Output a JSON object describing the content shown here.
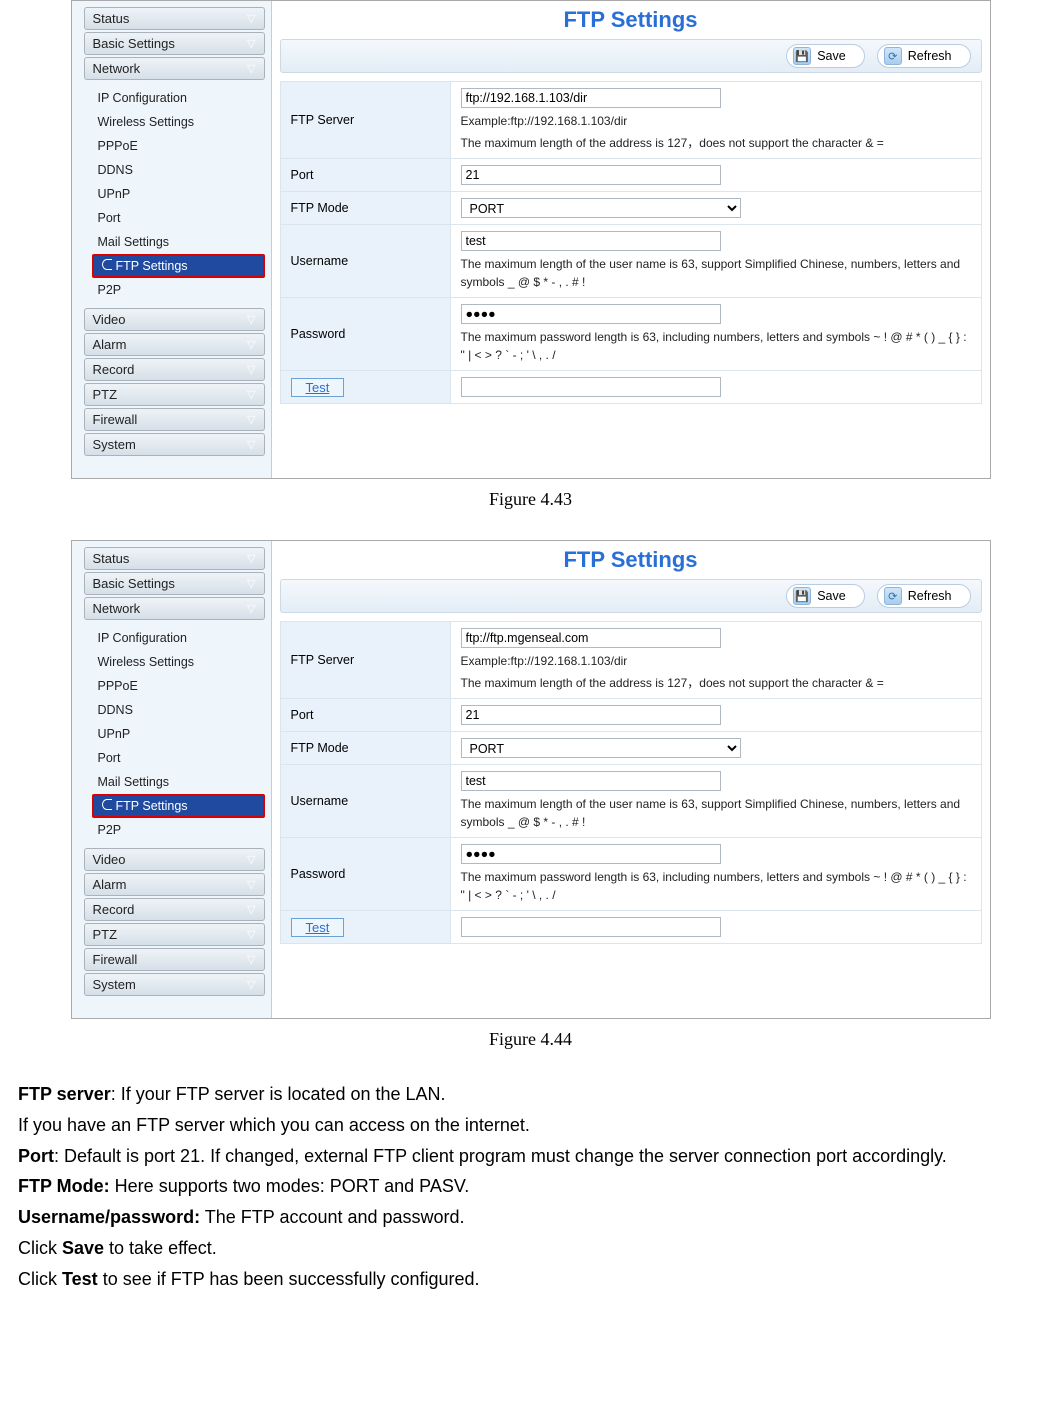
{
  "sidebar": {
    "categories": [
      {
        "label": "Status"
      },
      {
        "label": "Basic Settings"
      },
      {
        "label": "Network"
      },
      {
        "label": "Video"
      },
      {
        "label": "Alarm"
      },
      {
        "label": "Record"
      },
      {
        "label": "PTZ"
      },
      {
        "label": "Firewall"
      },
      {
        "label": "System"
      }
    ],
    "network_items": [
      {
        "label": "IP Configuration"
      },
      {
        "label": "Wireless Settings"
      },
      {
        "label": "PPPoE"
      },
      {
        "label": "DDNS"
      },
      {
        "label": "UPnP"
      },
      {
        "label": "Port"
      },
      {
        "label": "Mail Settings"
      },
      {
        "label": "FTP Settings"
      },
      {
        "label": "P2P"
      }
    ]
  },
  "panel": {
    "title": "FTP Settings",
    "save": "Save",
    "refresh": "Refresh",
    "labels": {
      "ftp_server": "FTP Server",
      "port": "Port",
      "ftp_mode": "FTP Mode",
      "username": "Username",
      "password": "Password",
      "test": "Test"
    },
    "hints": {
      "server_example": "Example:ftp://192.168.1.103/dir",
      "server_max": "The maximum length of the address is 127，does not support the character & =",
      "user_max": "The maximum length of the user name is 63, support Simplified Chinese, numbers, letters and symbols _ @ $ * - , . # !",
      "pass_max": "The maximum password length is 63, including numbers, letters and symbols ~ ! @ # * ( ) _ { } : \" | < > ? ` - ; ' \\ , . /"
    },
    "mode_option": "PORT"
  },
  "fig43": {
    "caption": "Figure 4.43",
    "server_value": "ftp://192.168.1.103/dir",
    "port_value": "21",
    "user_value": "test",
    "pass_value": "●●●●"
  },
  "fig44": {
    "caption": "Figure 4.44",
    "server_value": "ftp://ftp.mgenseal.com",
    "port_value": "21",
    "user_value": "test",
    "pass_value": "●●●●"
  },
  "doc": {
    "p1a": "FTP server",
    "p1b": ": If your FTP server is located on the LAN.",
    "p2": "If you have an FTP server which you can access on the internet.",
    "p3a": "Port",
    "p3b": ": Default is port 21. If changed, external FTP client program must change the server connection port accordingly.",
    "p4a": "FTP Mode:",
    "p4b": " Here supports two modes: PORT and PASV.",
    "p5a": "Username/password:",
    "p5b": " The FTP account and password.",
    "p6a": "Click ",
    "p6b": "Save",
    "p6c": " to take effect.",
    "p7a": "Click ",
    "p7b": "Test",
    "p7c": " to see if FTP has been successfully configured."
  }
}
